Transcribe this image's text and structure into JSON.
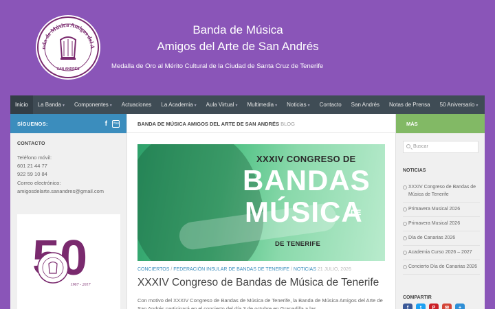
{
  "header": {
    "site_title_line1": "Banda de Música",
    "site_title_line2": "Amigos del Arte de San Andrés",
    "tagline": "Medalla de Oro al Mérito Cultural de la Ciudad de Santa Cruz de Tenerife",
    "logo_text": "Banda de Música Amigos del Arte",
    "logo_subtext": "SAN ANDRÉS"
  },
  "nav": {
    "items": [
      {
        "label": "Inicio",
        "dropdown": false,
        "active": true
      },
      {
        "label": "La Banda",
        "dropdown": true
      },
      {
        "label": "Componentes",
        "dropdown": true
      },
      {
        "label": "Actuaciones",
        "dropdown": false
      },
      {
        "label": "La Academia",
        "dropdown": true
      },
      {
        "label": "Aula Virtual",
        "dropdown": true
      },
      {
        "label": "Multimedia",
        "dropdown": true
      },
      {
        "label": "Noticias",
        "dropdown": true
      },
      {
        "label": "Contacto",
        "dropdown": false
      },
      {
        "label": "San Andrés",
        "dropdown": false
      },
      {
        "label": "Notas de Prensa",
        "dropdown": false
      },
      {
        "label": "50 Aniversario",
        "dropdown": true
      }
    ],
    "caret": "▾"
  },
  "left_sidebar": {
    "follow_label": "SÍGUENOS:",
    "facebook_glyph": "f",
    "youtube_glyph": "You",
    "contact_title": "CONTACTO",
    "contact_lines": [
      "Teléfono móvil:",
      "601 21 44 77",
      "922 59 10 84",
      "Correo electrónico:",
      "amigosdelarte.sanandres@gmail.com"
    ],
    "anniv_number": "50",
    "anniv_years": "1967 - 2017"
  },
  "main": {
    "breadcrumb": "BANDA DE MÚSICA AMIGOS DEL ARTE DE SAN ANDRÉS",
    "breadcrumb_suffix": "BLOG",
    "featured": {
      "line1": "XXXIV CONGRESO DE",
      "line2": "BANDAS",
      "line3": "MÚSICA",
      "line3_de": "DE",
      "line4": "DE TENERIFE"
    },
    "meta": {
      "cat1": "CONCIERTOS",
      "sep": "/",
      "cat2": "FEDERACIÓN INSULAR DE BANDAS DE TENERIFE",
      "cat3": "NOTICIAS",
      "date": "21 JULIO, 2026"
    },
    "post_title": "XXXIV Congreso de Bandas de Música de Tenerife",
    "excerpt": "Con motivo del XXXIV Congreso de Bandas de Música de Tenerife, la Banda de Música Amigos del Arte de San Andrés participará en el concierto del día 3 de octubre en Granadilla a las"
  },
  "right_sidebar": {
    "more_label": "MÁS",
    "search_placeholder": "Buscar",
    "news_title": "NOTICIAS",
    "news_items": [
      "XXXIV Congreso de Bandas de Música de Tenerife",
      "Primavera Musical 2026",
      "Primavera Musical 2026",
      "Día de Canarias 2026",
      "Academia Curso 2026 – 2027",
      "Concierto Día de Canarias 2026"
    ],
    "share_title": "COMPARTIR",
    "share_buttons": [
      {
        "glyph": "f",
        "color": "#3b5998"
      },
      {
        "glyph": "t",
        "color": "#1da1f2"
      },
      {
        "glyph": "P",
        "color": "#cb2027"
      },
      {
        "glyph": "✉",
        "color": "#d44638"
      },
      {
        "glyph": "+",
        "color": "#2f8fd6"
      }
    ]
  },
  "colors": {
    "page_bg": "#8a55b8",
    "nav_bg": "#3f4c55",
    "follow_bar": "#3b8dbd",
    "more_bar": "#82b965",
    "accent_link": "#3b8dbd",
    "logo_purple": "#7a2a6e"
  }
}
